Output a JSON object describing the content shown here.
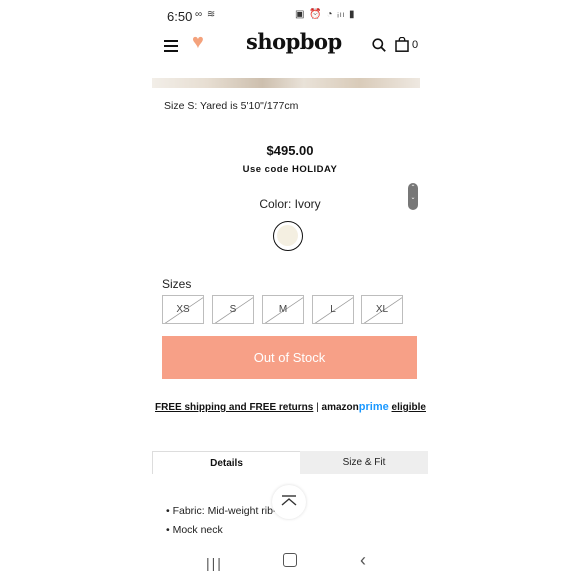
{
  "status_bar": {
    "time": "6:50",
    "left_icons": "∞ ≋",
    "right_icons": "▣ ⏰ ◔ ᵢₗₗ ▮"
  },
  "header": {
    "logo": "shopbop",
    "bag_count": "0"
  },
  "product": {
    "model_size": "Size S: Yared is 5'10\"/177cm",
    "price": "$495.00",
    "promo": "Use code HOLIDAY",
    "color_label": "Color: Ivory",
    "swatch_color": "#f4efe1",
    "sizes_label": "Sizes",
    "sizes": [
      "XS",
      "S",
      "M",
      "L",
      "XL"
    ],
    "button": "Out of Stock",
    "button_color": "#f7a087"
  },
  "shipping": {
    "free_text": "FREE shipping and FREE returns",
    "separator": "|",
    "amazon": "amazon",
    "prime": "prime",
    "eligible": "eligible"
  },
  "tabs": {
    "details": "Details",
    "size_fit": "Size & Fit"
  },
  "details": [
    "Fabric: Mid-weight rib-knit",
    "Mock neck"
  ]
}
